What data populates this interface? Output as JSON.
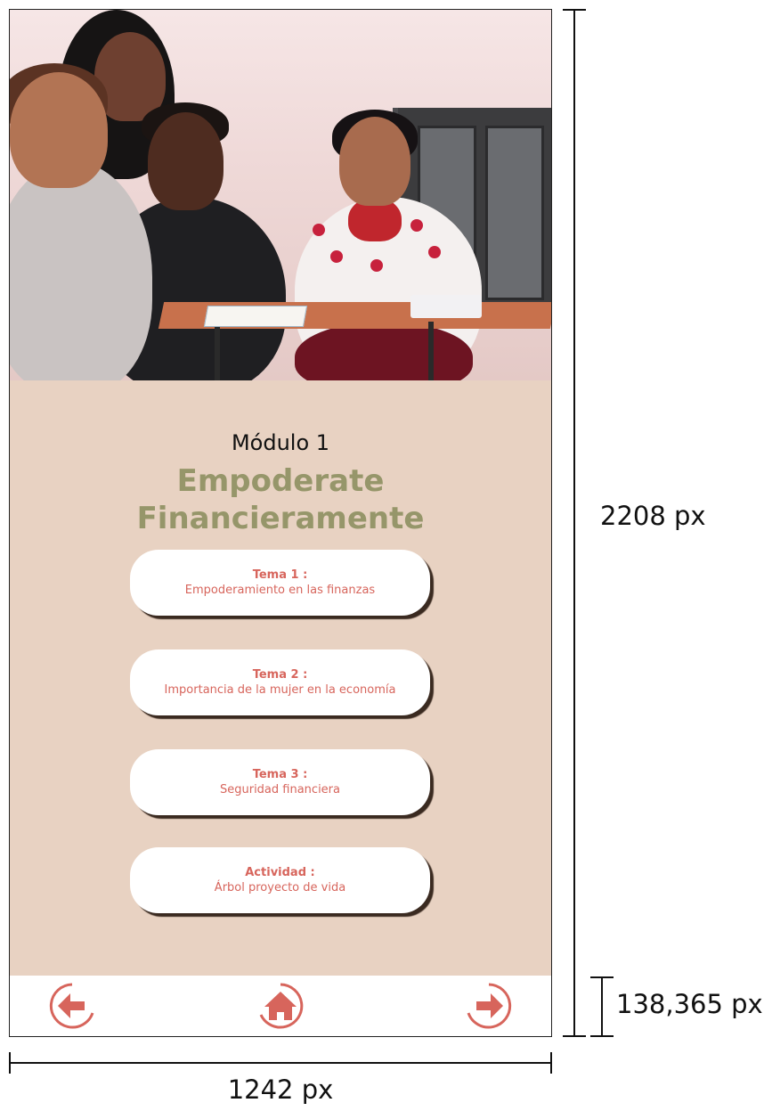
{
  "screen": {
    "module_label": "Módulo 1",
    "module_title_line1": "Empoderate",
    "module_title_line2": "Financieramente",
    "topics": [
      {
        "title": "Tema 1 :",
        "subtitle": "Empoderamiento en las finanzas"
      },
      {
        "title": "Tema 2 :",
        "subtitle": "Importancia de la mujer en la economía"
      },
      {
        "title": "Tema 3 :",
        "subtitle": "Seguridad financiera"
      },
      {
        "title": "Actividad :",
        "subtitle": "Árbol proyecto de vida"
      }
    ],
    "nav": {
      "back_icon": "arrow-left-icon",
      "home_icon": "home-icon",
      "next_icon": "arrow-right-icon"
    }
  },
  "annotations": {
    "height_label": "2208 px",
    "navbar_height_label": "138,365 px",
    "width_label": "1242 px"
  },
  "colors": {
    "background": "#e8d2c2",
    "title_green": "#96966a",
    "accent_coral": "#d7655c",
    "button_bg": "#ffffff"
  }
}
